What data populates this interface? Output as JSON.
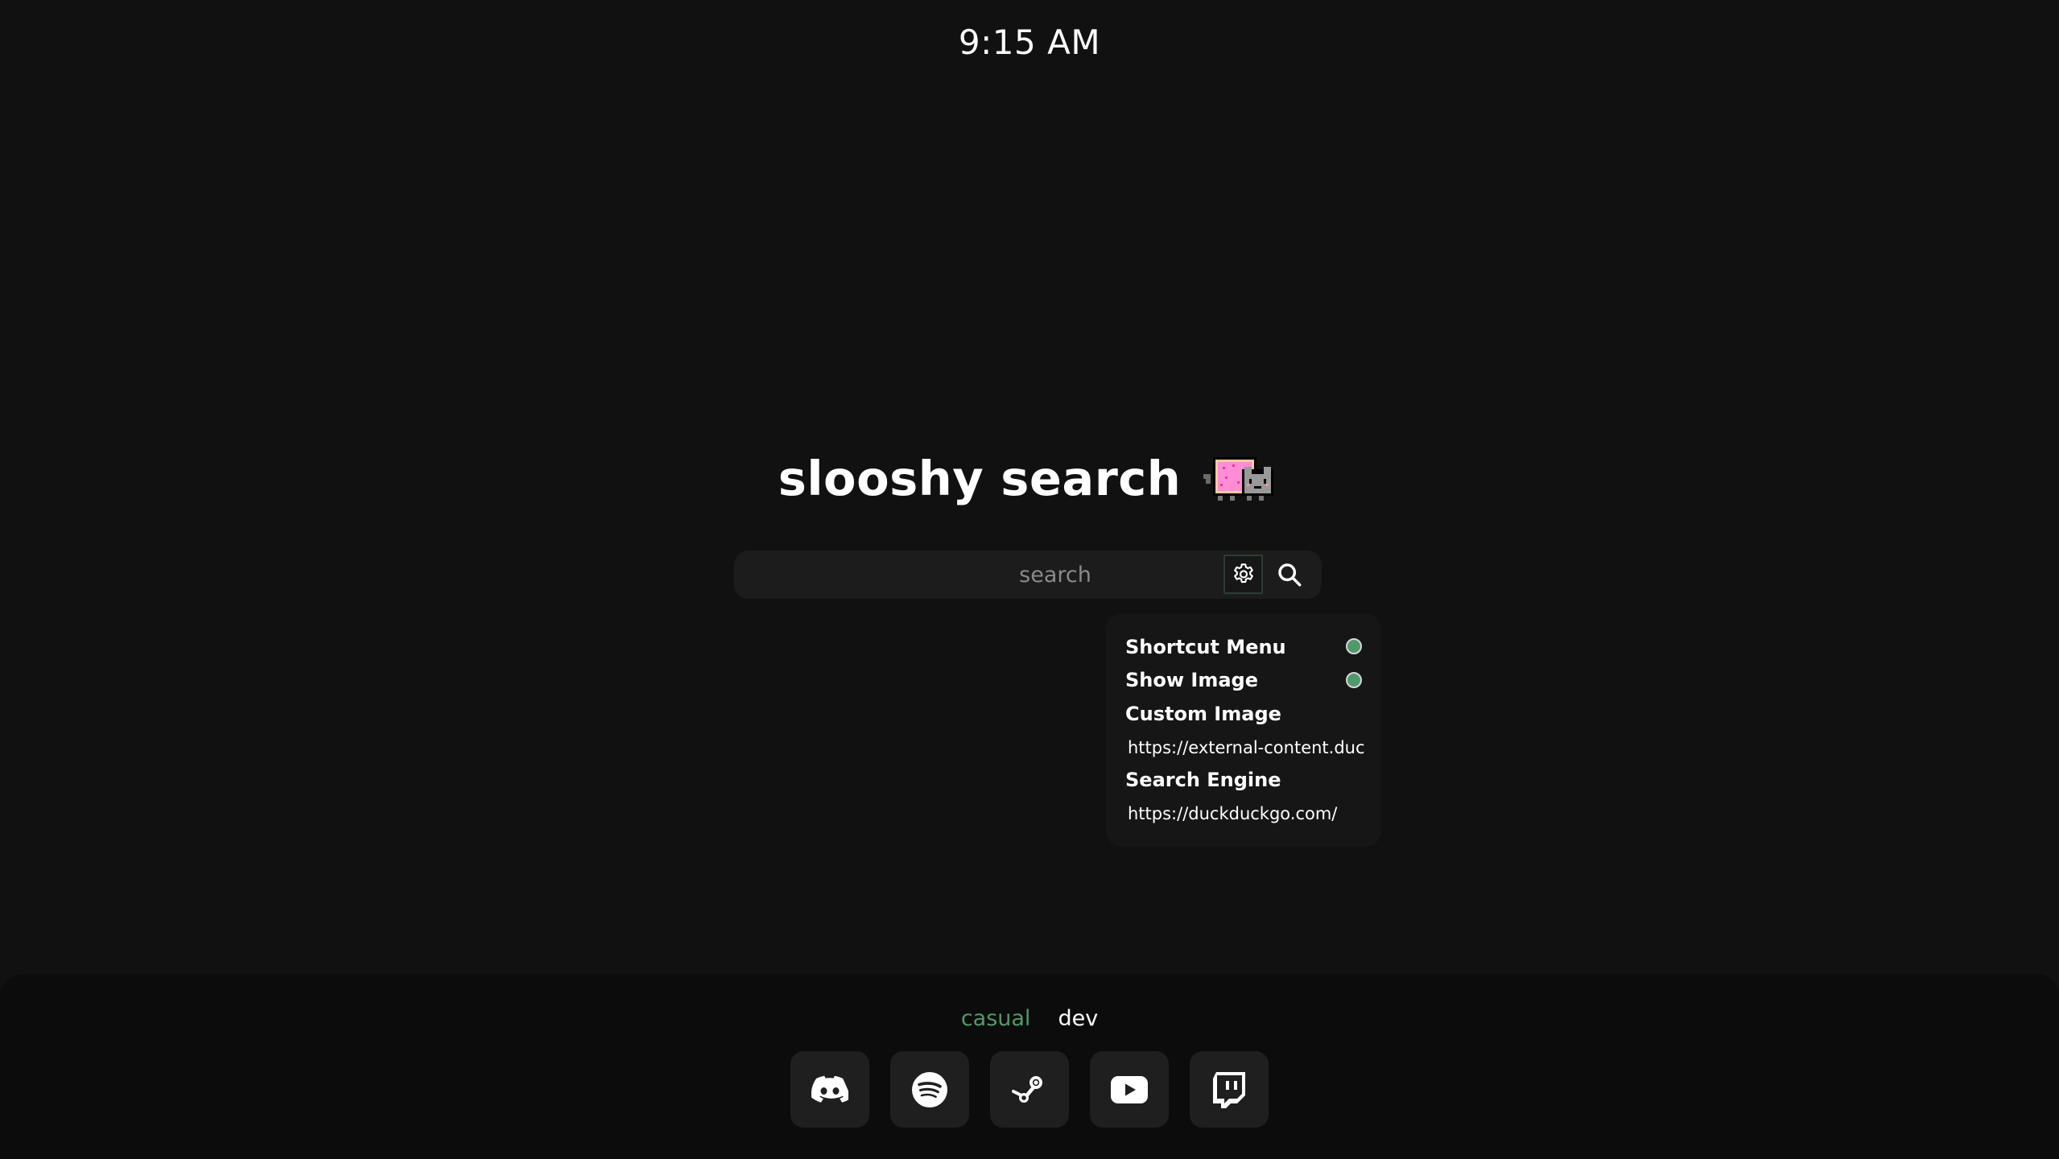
{
  "clock": {
    "time": "9:15 AM"
  },
  "header": {
    "title": "slooshy search",
    "logo_icon": "nyan-cat-icon"
  },
  "search": {
    "placeholder": "search",
    "value": "",
    "settings_icon": "gear-icon",
    "submit_icon": "search-icon"
  },
  "settings": {
    "shortcut_menu": {
      "label": "Shortcut Menu",
      "enabled": true
    },
    "show_image": {
      "label": "Show Image",
      "enabled": true
    },
    "custom_image": {
      "label": "Custom Image",
      "value": "https://external-content.duckduckgo.com/"
    },
    "search_engine": {
      "label": "Search Engine",
      "value": "https://duckduckgo.com/"
    }
  },
  "dock": {
    "tabs": [
      {
        "label": "casual",
        "active": true
      },
      {
        "label": "dev",
        "active": false
      }
    ],
    "shortcuts": [
      {
        "icon": "discord-icon"
      },
      {
        "icon": "spotify-icon"
      },
      {
        "icon": "steam-icon"
      },
      {
        "icon": "youtube-icon"
      },
      {
        "icon": "twitch-icon"
      }
    ]
  },
  "colors": {
    "background": "#111111",
    "accent": "#4f9a6a",
    "panel": "#161616",
    "searchbar": "#1c1c1c",
    "dock": "#0c0c0c",
    "dock_button": "#1f1f1f"
  }
}
